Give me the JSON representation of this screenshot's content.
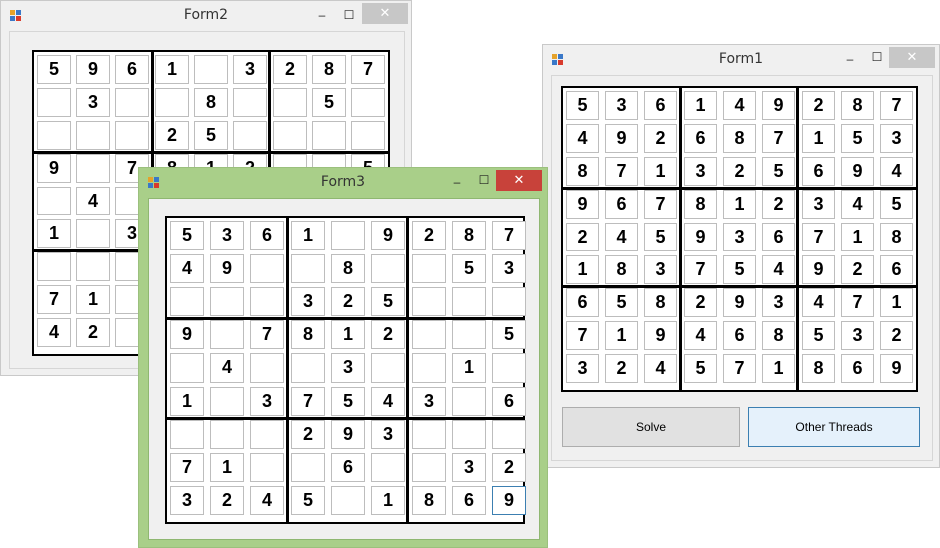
{
  "form2": {
    "title": "Form2",
    "controls": {
      "minimize": "–",
      "maximize": "☐",
      "close": "✕"
    },
    "grid": [
      [
        "5",
        "9",
        "6",
        "1",
        "",
        "3",
        "2",
        "8",
        "7"
      ],
      [
        "",
        "3",
        "",
        "",
        "8",
        "",
        "",
        "5",
        ""
      ],
      [
        "",
        "",
        "",
        "2",
        "5",
        "",
        "",
        "",
        ""
      ],
      [
        "9",
        "",
        "7",
        "8",
        "1",
        "2",
        "",
        "",
        "5"
      ],
      [
        "",
        "4",
        "",
        "",
        "",
        "",
        "",
        "",
        ""
      ],
      [
        "1",
        "",
        "3",
        "",
        "",
        "",
        "",
        "",
        ""
      ],
      [
        "",
        "",
        "",
        "",
        "",
        "",
        "",
        "",
        ""
      ],
      [
        "7",
        "1",
        "",
        "",
        "",
        "",
        "",
        "",
        ""
      ],
      [
        "4",
        "2",
        "",
        "",
        "",
        "",
        "",
        "",
        ""
      ]
    ]
  },
  "form1": {
    "title": "Form1",
    "controls": {
      "minimize": "–",
      "maximize": "☐",
      "close": "✕"
    },
    "grid": [
      [
        "5",
        "3",
        "6",
        "1",
        "4",
        "9",
        "2",
        "8",
        "7"
      ],
      [
        "4",
        "9",
        "2",
        "6",
        "8",
        "7",
        "1",
        "5",
        "3"
      ],
      [
        "8",
        "7",
        "1",
        "3",
        "2",
        "5",
        "6",
        "9",
        "4"
      ],
      [
        "9",
        "6",
        "7",
        "8",
        "1",
        "2",
        "3",
        "4",
        "5"
      ],
      [
        "2",
        "4",
        "5",
        "9",
        "3",
        "6",
        "7",
        "1",
        "8"
      ],
      [
        "1",
        "8",
        "3",
        "7",
        "5",
        "4",
        "9",
        "2",
        "6"
      ],
      [
        "6",
        "5",
        "8",
        "2",
        "9",
        "3",
        "4",
        "7",
        "1"
      ],
      [
        "7",
        "1",
        "9",
        "4",
        "6",
        "8",
        "5",
        "3",
        "2"
      ],
      [
        "3",
        "2",
        "4",
        "5",
        "7",
        "1",
        "8",
        "6",
        "9"
      ]
    ],
    "buttons": {
      "solve": "Solve",
      "other_threads": "Other Threads"
    }
  },
  "form3": {
    "title": "Form3",
    "controls": {
      "minimize": "–",
      "maximize": "☐",
      "close": "✕"
    },
    "grid": [
      [
        "5",
        "3",
        "6",
        "1",
        "",
        "9",
        "2",
        "8",
        "7"
      ],
      [
        "4",
        "9",
        "",
        "",
        "8",
        "",
        "",
        "5",
        "3"
      ],
      [
        "",
        "",
        "",
        "3",
        "2",
        "5",
        "",
        "",
        ""
      ],
      [
        "9",
        "",
        "7",
        "8",
        "1",
        "2",
        "",
        "",
        "5"
      ],
      [
        "",
        "4",
        "",
        "",
        "3",
        "",
        "",
        "1",
        ""
      ],
      [
        "1",
        "",
        "3",
        "7",
        "5",
        "4",
        "3",
        "",
        "6"
      ],
      [
        "",
        "",
        "",
        "2",
        "9",
        "3",
        "",
        "",
        ""
      ],
      [
        "7",
        "1",
        "",
        "",
        "6",
        "",
        "",
        "3",
        "2"
      ],
      [
        "3",
        "2",
        "4",
        "5",
        "",
        "1",
        "8",
        "6",
        "9"
      ]
    ]
  },
  "colors": {
    "active_frame": "#a9cf89",
    "close_active": "#c8423a",
    "focus": "#3c7fb1"
  }
}
